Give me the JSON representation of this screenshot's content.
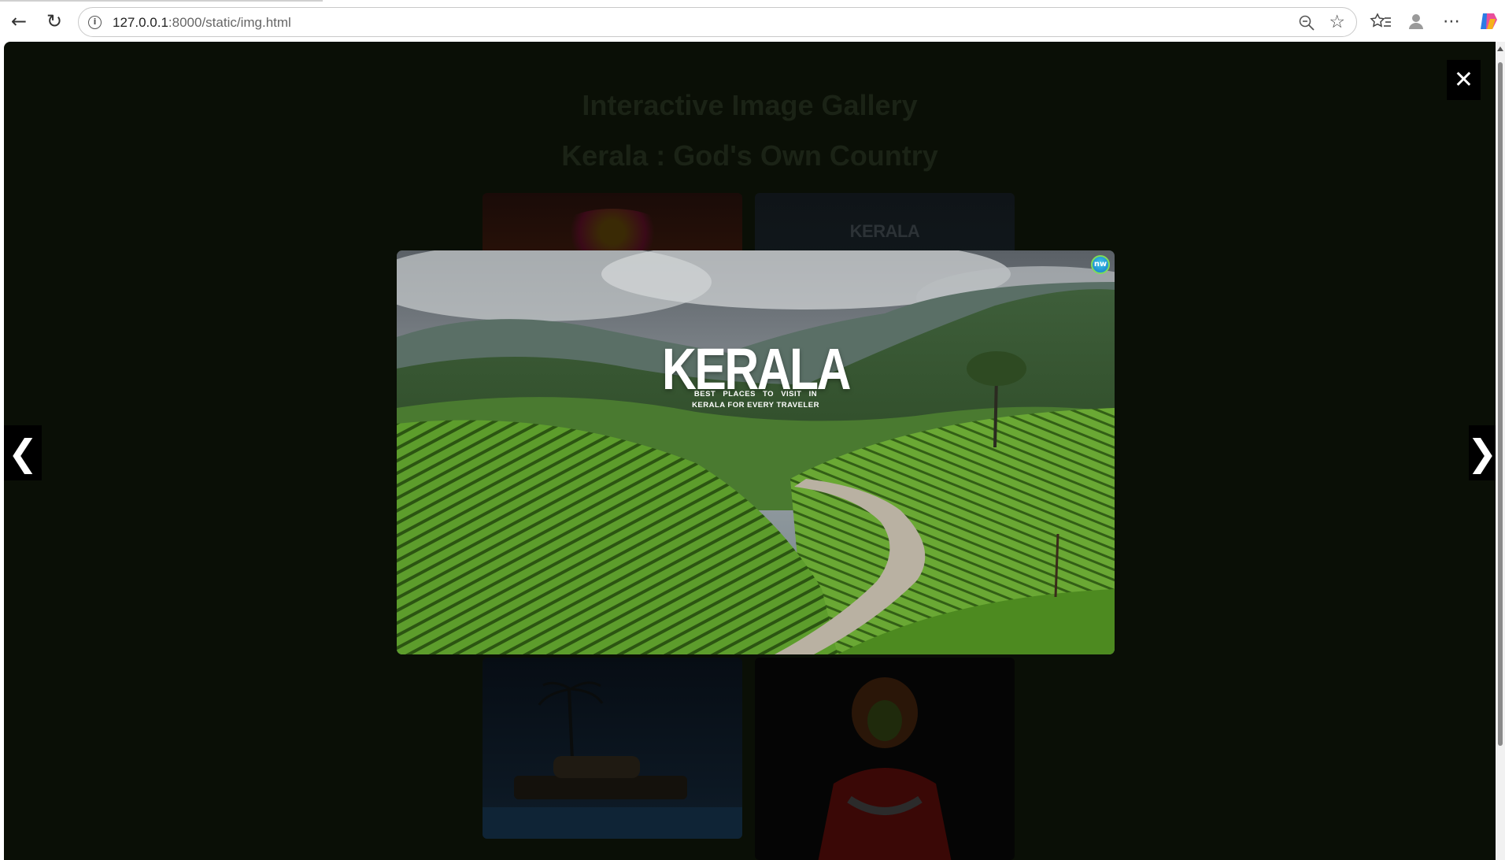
{
  "browser": {
    "url_host": "127.0.0.1",
    "url_rest": ":8000/static/img.html",
    "back_icon": "back-arrow-icon",
    "reload_icon": "reload-icon"
  },
  "page": {
    "heading": "Interactive Image Gallery",
    "subheading": "Kerala : God's Own Country",
    "thumb2_text": "KERALA"
  },
  "lightbox": {
    "title": "KERALA",
    "subtitle_line1": "BEST PLACES TO VISIT IN",
    "subtitle_line2": "KERALA FOR EVERY TRAVELER",
    "logo_text": "nw",
    "close_label": "✕",
    "prev_label": "❮",
    "next_label": "❯"
  },
  "colors": {
    "overlay": "#0a0f06",
    "accent_green": "#5a9a2a"
  }
}
